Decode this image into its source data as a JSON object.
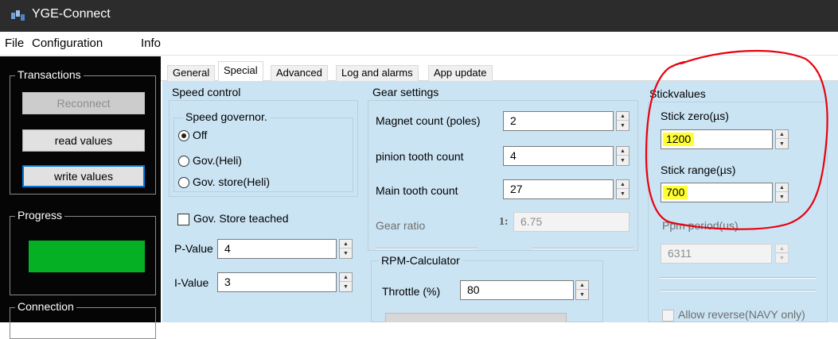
{
  "window": {
    "title": "YGE-Connect",
    "icon": "app-icon"
  },
  "menu": [
    "File",
    "Configuration",
    "Info"
  ],
  "left_panel": {
    "transactions": {
      "title": "Transactions",
      "buttons": {
        "reconnect": "Reconnect",
        "read": "read values",
        "write": "write values"
      }
    },
    "progress": {
      "title": "Progress",
      "value_pct": 100,
      "color": "#06b025"
    },
    "connection": {
      "title": "Connection"
    }
  },
  "tabs": [
    "General",
    "Special",
    "Advanced",
    "Log and alarms",
    "App update"
  ],
  "active_tab": "Special",
  "speed_control": {
    "title": "Speed control",
    "governor": {
      "title": "Speed governor.",
      "options": [
        "Off",
        "Gov.(Heli)",
        "Gov. store(Heli)"
      ],
      "selected": "Off"
    },
    "gov_store_teached": {
      "label": "Gov. Store teached",
      "checked": false
    },
    "p_value": {
      "label": "P-Value",
      "value": "4"
    },
    "i_value": {
      "label": "I-Value",
      "value": "3"
    }
  },
  "gear_settings": {
    "title": "Gear settings",
    "magnet_count": {
      "label": "Magnet count (poles)",
      "value": "2"
    },
    "pinion_tooth": {
      "label": "pinion tooth count",
      "value": "4"
    },
    "main_tooth": {
      "label": "Main tooth count",
      "value": "27"
    },
    "gear_ratio": {
      "label": "Gear ratio",
      "prefix": "1:",
      "value": "6.75"
    }
  },
  "rpm_calculator": {
    "title": "RPM-Calculator",
    "throttle": {
      "label": "Throttle (%)",
      "value": "80"
    }
  },
  "stickvalues": {
    "title": "Stickvalues",
    "stick_zero": {
      "label": "Stick zero(µs)",
      "value": "1200"
    },
    "stick_range": {
      "label": "Stick range(µs)",
      "value": "700"
    },
    "ppm_period": {
      "label": "Ppm period(us)",
      "value": "6311"
    },
    "allow_reverse": {
      "label": "Allow reverse(NAVY only)",
      "checked": false
    }
  },
  "colors": {
    "highlight": "#ffff33",
    "annotation": "#e8000d",
    "panel_bg": "#cbe4f4",
    "progress": "#06b025"
  }
}
